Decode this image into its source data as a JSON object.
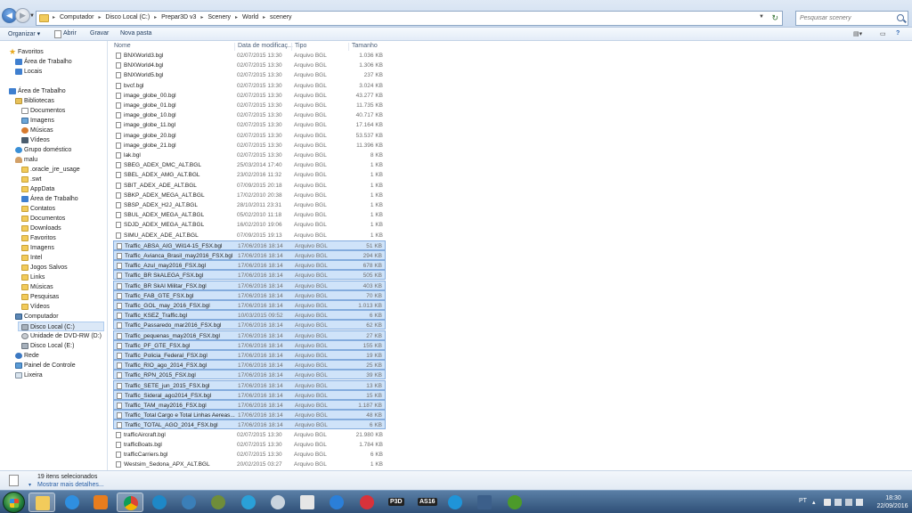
{
  "address": {
    "crumbs": [
      "Computador",
      "Disco Local (C:)",
      "Prepar3D v3",
      "Scenery",
      "World",
      "scenery"
    ]
  },
  "search": {
    "placeholder": "Pesquisar scenery"
  },
  "toolbar": {
    "organize": "Organizar",
    "open": "Abrir",
    "record": "Gravar",
    "new_folder": "Nova pasta"
  },
  "sidebar": {
    "items": [
      {
        "label": "Favoritos",
        "icon": "star-icon"
      },
      {
        "label": "Área de Trabalho",
        "icon": "desktop-icon"
      },
      {
        "label": "Locais",
        "icon": "places-icon"
      },
      {
        "label": "Área de Trabalho",
        "icon": "desktop-icon"
      },
      {
        "label": "Bibliotecas",
        "icon": "library-icon"
      },
      {
        "label": "Documentos",
        "icon": "documents-icon"
      },
      {
        "label": "Imagens",
        "icon": "pictures-icon"
      },
      {
        "label": "Músicas",
        "icon": "music-icon"
      },
      {
        "label": "Vídeos",
        "icon": "videos-icon"
      },
      {
        "label": "Grupo doméstico",
        "icon": "homegroup-icon"
      },
      {
        "label": "malu",
        "icon": "user-icon"
      },
      {
        "label": ".oracle_jre_usage",
        "icon": "folder-icon"
      },
      {
        "label": ".swt",
        "icon": "folder-icon"
      },
      {
        "label": "AppData",
        "icon": "folder-icon"
      },
      {
        "label": "Área de Trabalho",
        "icon": "desktop-icon"
      },
      {
        "label": "Contatos",
        "icon": "contacts-icon"
      },
      {
        "label": "Documentos",
        "icon": "documents-icon"
      },
      {
        "label": "Downloads",
        "icon": "downloads-icon"
      },
      {
        "label": "Favoritos",
        "icon": "favorites-icon"
      },
      {
        "label": "Imagens",
        "icon": "pictures-icon"
      },
      {
        "label": "Intel",
        "icon": "folder-icon"
      },
      {
        "label": "Jogos Salvos",
        "icon": "saved-games-icon"
      },
      {
        "label": "Links",
        "icon": "links-icon"
      },
      {
        "label": "Músicas",
        "icon": "music-icon"
      },
      {
        "label": "Pesquisas",
        "icon": "searches-icon"
      },
      {
        "label": "Vídeos",
        "icon": "videos-icon"
      },
      {
        "label": "Computador",
        "icon": "computer-icon"
      },
      {
        "label": "Disco Local (C:)",
        "icon": "disk-icon"
      },
      {
        "label": "Unidade de DVD-RW (D:)",
        "icon": "dvd-icon"
      },
      {
        "label": "Disco Local (E:)",
        "icon": "disk-icon"
      },
      {
        "label": "Rede",
        "icon": "network-icon"
      },
      {
        "label": "Painel de Controle",
        "icon": "control-panel-icon"
      },
      {
        "label": "Lixeira",
        "icon": "recycle-bin-icon"
      }
    ]
  },
  "columns": {
    "name": "Nome",
    "date": "Data de modificaç...",
    "type": "Tipo",
    "size": "Tamanho"
  },
  "files": [
    {
      "name": "BNXWorld3.bgl",
      "date": "02/07/2015 13:30",
      "type": "Arquivo BGL",
      "size": "1.036 KB",
      "selected": false
    },
    {
      "name": "BNXWorld4.bgl",
      "date": "02/07/2015 13:30",
      "type": "Arquivo BGL",
      "size": "1.306 KB",
      "selected": false
    },
    {
      "name": "BNXWorld5.bgl",
      "date": "02/07/2015 13:30",
      "type": "Arquivo BGL",
      "size": "237 KB",
      "selected": false
    },
    {
      "name": "bvcf.bgl",
      "date": "02/07/2015 13:30",
      "type": "Arquivo BGL",
      "size": "3.024 KB",
      "selected": false
    },
    {
      "name": "image_globe_00.bgl",
      "date": "02/07/2015 13:30",
      "type": "Arquivo BGL",
      "size": "43.277 KB",
      "selected": false
    },
    {
      "name": "image_globe_01.bgl",
      "date": "02/07/2015 13:30",
      "type": "Arquivo BGL",
      "size": "11.735 KB",
      "selected": false
    },
    {
      "name": "image_globe_10.bgl",
      "date": "02/07/2015 13:30",
      "type": "Arquivo BGL",
      "size": "40.717 KB",
      "selected": false
    },
    {
      "name": "image_globe_11.bgl",
      "date": "02/07/2015 13:30",
      "type": "Arquivo BGL",
      "size": "17.164 KB",
      "selected": false
    },
    {
      "name": "image_globe_20.bgl",
      "date": "02/07/2015 13:30",
      "type": "Arquivo BGL",
      "size": "53.537 KB",
      "selected": false
    },
    {
      "name": "image_globe_21.bgl",
      "date": "02/07/2015 13:30",
      "type": "Arquivo BGL",
      "size": "11.396 KB",
      "selected": false
    },
    {
      "name": "lak.bgl",
      "date": "02/07/2015 13:30",
      "type": "Arquivo BGL",
      "size": "8 KB",
      "selected": false
    },
    {
      "name": "SBEG_ADEX_DMC_ALT.BGL",
      "date": "25/03/2014 17:40",
      "type": "Arquivo BGL",
      "size": "1 KB",
      "selected": false
    },
    {
      "name": "SBEL_ADEX_AMG_ALT.BGL",
      "date": "23/02/2016 11:32",
      "type": "Arquivo BGL",
      "size": "1 KB",
      "selected": false
    },
    {
      "name": "SBIT_ADEX_ADE_ALT.BGL",
      "date": "07/09/2015 20:18",
      "type": "Arquivo BGL",
      "size": "1 KB",
      "selected": false
    },
    {
      "name": "SBKP_ADEX_MEGA_ALT.BGL",
      "date": "17/02/2010 20:38",
      "type": "Arquivo BGL",
      "size": "1 KB",
      "selected": false
    },
    {
      "name": "SBSP_ADEX_H2J_ALT.BGL",
      "date": "28/10/2011 23:31",
      "type": "Arquivo BGL",
      "size": "1 KB",
      "selected": false
    },
    {
      "name": "SBUL_ADEX_MEGA_ALT.BGL",
      "date": "05/02/2010 11:18",
      "type": "Arquivo BGL",
      "size": "1 KB",
      "selected": false
    },
    {
      "name": "SDJD_ADEX_MEGA_ALT.BGL",
      "date": "16/02/2010 19:06",
      "type": "Arquivo BGL",
      "size": "1 KB",
      "selected": false
    },
    {
      "name": "SIMU_ADEX_ADE_ALT.BGL",
      "date": "07/09/2015 19:13",
      "type": "Arquivo BGL",
      "size": "1 KB",
      "selected": false
    },
    {
      "name": "Traffic_ABSA_AIG_Wil14-15_FSX.bgl",
      "date": "17/06/2016 18:14",
      "type": "Arquivo BGL",
      "size": "51 KB",
      "selected": true
    },
    {
      "name": "Traffic_Avianca_Brasil_may2016_FSX.bgl",
      "date": "17/06/2016 18:14",
      "type": "Arquivo BGL",
      "size": "294 KB",
      "selected": true
    },
    {
      "name": "Traffic_Azul_may2016_FSX.bgl",
      "date": "17/06/2016 18:14",
      "type": "Arquivo BGL",
      "size": "678 KB",
      "selected": true
    },
    {
      "name": "Traffic_BR SkALEGA_FSX.bgl",
      "date": "17/06/2016 18:14",
      "type": "Arquivo BGL",
      "size": "505 KB",
      "selected": true
    },
    {
      "name": "Traffic_BR SkAI Militar_FSX.bgl",
      "date": "17/06/2016 18:14",
      "type": "Arquivo BGL",
      "size": "403 KB",
      "selected": true
    },
    {
      "name": "Traffic_FAB_GTE_FSX.bgl",
      "date": "17/06/2016 18:14",
      "type": "Arquivo BGL",
      "size": "70 KB",
      "selected": true
    },
    {
      "name": "Traffic_GOL_may_2016_FSX.bgl",
      "date": "17/06/2016 18:14",
      "type": "Arquivo BGL",
      "size": "1.013 KB",
      "selected": true
    },
    {
      "name": "Traffic_KSEZ_Traffic.bgl",
      "date": "10/03/2015 09:52",
      "type": "Arquivo BGL",
      "size": "6 KB",
      "selected": true
    },
    {
      "name": "Traffic_Passaredo_mar2016_FSX.bgl",
      "date": "17/06/2016 18:14",
      "type": "Arquivo BGL",
      "size": "62 KB",
      "selected": true
    },
    {
      "name": "Traffic_pequenas_may2016_FSX.bgl",
      "date": "17/06/2016 18:14",
      "type": "Arquivo BGL",
      "size": "27 KB",
      "selected": true
    },
    {
      "name": "Traffic_PF_GTE_FSX.bgl",
      "date": "17/06/2016 18:14",
      "type": "Arquivo BGL",
      "size": "155 KB",
      "selected": true
    },
    {
      "name": "Traffic_Policia_Federal_FSX.bgl",
      "date": "17/06/2016 18:14",
      "type": "Arquivo BGL",
      "size": "19 KB",
      "selected": true
    },
    {
      "name": "Traffic_RIO_ago_2014_FSX.bgl",
      "date": "17/06/2016 18:14",
      "type": "Arquivo BGL",
      "size": "25 KB",
      "selected": true
    },
    {
      "name": "Traffic_RPN_2015_FSX.bgl",
      "date": "17/06/2016 18:14",
      "type": "Arquivo BGL",
      "size": "39 KB",
      "selected": true
    },
    {
      "name": "Traffic_SETE_jun_2015_FSX.bgl",
      "date": "17/06/2016 18:14",
      "type": "Arquivo BGL",
      "size": "13 KB",
      "selected": true
    },
    {
      "name": "Traffic_Sideral_ago2014_FSX.bgl",
      "date": "17/06/2016 18:14",
      "type": "Arquivo BGL",
      "size": "15 KB",
      "selected": true
    },
    {
      "name": "Traffic_TAM_may2016_FSX.bgl",
      "date": "17/06/2016 18:14",
      "type": "Arquivo BGL",
      "size": "1.187 KB",
      "selected": true
    },
    {
      "name": "Traffic_Total Cargo e Total Linhas Aereas...",
      "date": "17/06/2016 18:14",
      "type": "Arquivo BGL",
      "size": "48 KB",
      "selected": true
    },
    {
      "name": "Traffic_TOTAL_AGO_2014_FSX.bgl",
      "date": "17/06/2016 18:14",
      "type": "Arquivo BGL",
      "size": "6 KB",
      "selected": true
    },
    {
      "name": "trafficAircraft.bgl",
      "date": "02/07/2015 13:30",
      "type": "Arquivo BGL",
      "size": "21.980 KB",
      "selected": false
    },
    {
      "name": "trafficBoats.bgl",
      "date": "02/07/2015 13:30",
      "type": "Arquivo BGL",
      "size": "1.784 KB",
      "selected": false
    },
    {
      "name": "trafficCarriers.bgl",
      "date": "02/07/2015 13:30",
      "type": "Arquivo BGL",
      "size": "6 KB",
      "selected": false
    },
    {
      "name": "Westsim_Sedona_APX_ALT.BGL",
      "date": "20/02/2015 03:27",
      "type": "Arquivo BGL",
      "size": "1 KB",
      "selected": false
    }
  ],
  "status": {
    "selected_count": "19 itens selecionados",
    "show_more": "Mostrar mais detalhes..."
  },
  "taskbar": {
    "apps": [
      "folder-icon",
      "ie-icon",
      "media-player-icon",
      "chrome-icon",
      "refresh-app-icon",
      "map-app-icon",
      "cloud-download-icon",
      "cloud-icon",
      "weather-icon",
      "edge-icon",
      "molecule-icon",
      "p3d-app",
      "asis-app",
      "skype-icon",
      "radar-icon",
      "xbox-icon"
    ],
    "p3d_label": "P3D",
    "asis_label": "AS16",
    "lang": "PT",
    "time": "18:30",
    "date": "22/09/2016"
  },
  "colors": {
    "selection": "#cfe3f9",
    "selection_border": "#84acdd",
    "taskbar": "#2f5077"
  }
}
